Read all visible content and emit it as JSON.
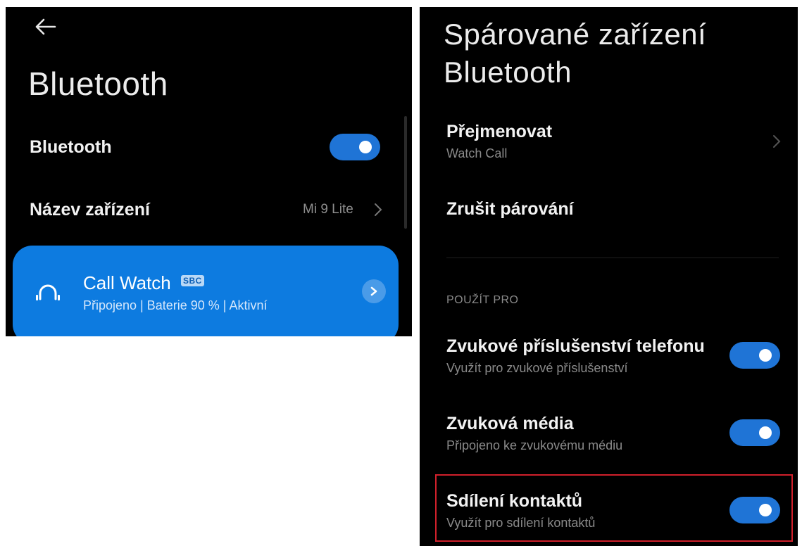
{
  "left_screen": {
    "title": "Bluetooth",
    "bluetooth_row": {
      "label": "Bluetooth",
      "enabled": true
    },
    "device_name_row": {
      "label": "Název zařízení",
      "value": "Mi 9 Lite"
    },
    "paired_device": {
      "name": "Call Watch",
      "codec_badge": "SBC",
      "status": "Připojeno | Baterie 90 % | Aktivní",
      "icon": "headset-icon"
    }
  },
  "right_screen": {
    "title": "Spárované zařízení Bluetooth",
    "rename": {
      "label": "Přejmenovat",
      "value": "Watch Call"
    },
    "unpair": {
      "label": "Zrušit párování"
    },
    "section_header": "POUŽÍT PRO",
    "options": [
      {
        "label": "Zvukové příslušenství telefonu",
        "subtitle": "Využít pro zvukové příslušenství",
        "enabled": true
      },
      {
        "label": "Zvuková média",
        "subtitle": "Připojeno ke zvukovému médiu",
        "enabled": true
      },
      {
        "label": "Sdílení kontaktů",
        "subtitle": "Využít pro sdílení kontaktů",
        "enabled": true,
        "highlighted": true
      }
    ]
  },
  "colors": {
    "background": "#000000",
    "toggle_on": "#1f74d6",
    "card_blue": "#0d7be0",
    "highlight_border": "#d0202b"
  }
}
